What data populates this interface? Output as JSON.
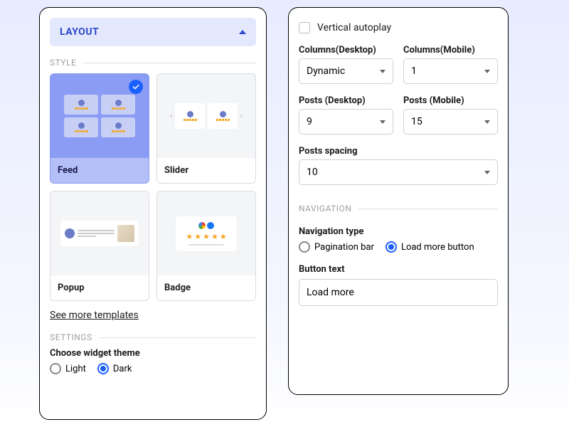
{
  "left": {
    "accordion": "LAYOUT",
    "style_label": "STYLE",
    "cards": {
      "feed": "Feed",
      "slider": "Slider",
      "popup": "Popup",
      "badge": "Badge"
    },
    "more_link": "See more templates",
    "settings_label": "SETTINGS",
    "theme": {
      "label": "Choose widget theme",
      "light": "Light",
      "dark": "Dark",
      "selected": "dark"
    }
  },
  "right": {
    "autoplay": "Vertical autoplay",
    "cols_desktop": {
      "label": "Columns(Desktop)",
      "value": "Dynamic"
    },
    "cols_mobile": {
      "label": "Columns(Mobile)",
      "value": "1"
    },
    "posts_desktop": {
      "label": "Posts (Desktop)",
      "value": "9"
    },
    "posts_mobile": {
      "label": "Posts (Mobile)",
      "value": "15"
    },
    "spacing": {
      "label": "Posts spacing",
      "value": "10"
    },
    "nav_label": "NAVIGATION",
    "nav_type": {
      "label": "Navigation type",
      "pagination": "Pagination bar",
      "loadmore": "Load more button",
      "selected": "loadmore"
    },
    "button_text": {
      "label": "Button text",
      "value": "Load more"
    }
  }
}
